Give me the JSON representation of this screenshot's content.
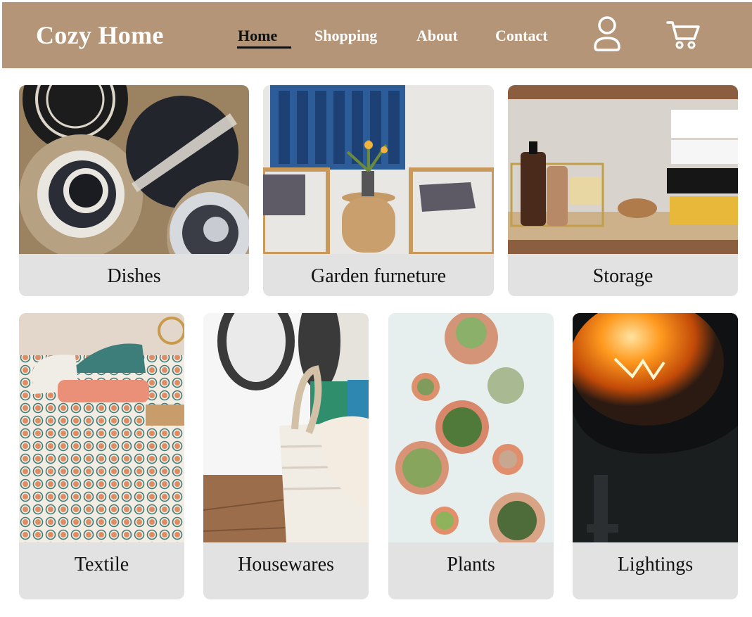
{
  "header": {
    "logo": "Cozy Home",
    "nav": [
      {
        "label": "Home",
        "active": true
      },
      {
        "label": "Shopping",
        "active": false
      },
      {
        "label": "About",
        "active": false
      },
      {
        "label": "Contact",
        "active": false
      }
    ],
    "icons": [
      "user-icon",
      "cart-icon"
    ],
    "background_color": "#b59577"
  },
  "categories_row1": [
    {
      "label": "Dishes",
      "image": "dishes-photo"
    },
    {
      "label": "Garden furneture",
      "image": "garden-furniture-photo"
    },
    {
      "label": "Storage",
      "image": "storage-photo"
    }
  ],
  "categories_row2": [
    {
      "label": "Textile",
      "image": "textile-photo"
    },
    {
      "label": "Housewares",
      "image": "housewares-photo"
    },
    {
      "label": "Plants",
      "image": "plants-photo"
    },
    {
      "label": "Lightings",
      "image": "lightings-photo"
    }
  ]
}
